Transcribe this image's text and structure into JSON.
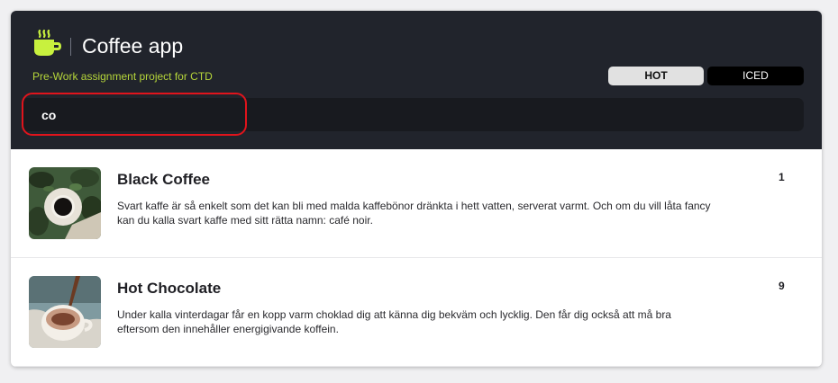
{
  "header": {
    "title": "Coffee app",
    "subtitle": "Pre-Work assignment project for CTD",
    "subtitle_color": "#b6d63a",
    "logo_color": "#c8f13e"
  },
  "toggles": {
    "hot": "HOT",
    "iced": "ICED",
    "selected": "HOT"
  },
  "search": {
    "value": "co",
    "placeholder": ""
  },
  "items": [
    {
      "name": "Black Coffee",
      "description": "Svart kaffe är så enkelt som det kan bli med malda kaffebönor dränkta i hett vatten, serverat varmt. Och om du vill låta fancy kan du kalla svart kaffe med sitt rätta namn: café noir.",
      "count": "1"
    },
    {
      "name": "Hot Chocolate",
      "description": "Under kalla vinterdagar får en kopp varm choklad dig att känna dig bekväm och lycklig. Den får dig också att må bra eftersom den innehåller energigivande koffein.",
      "count": "9"
    }
  ]
}
